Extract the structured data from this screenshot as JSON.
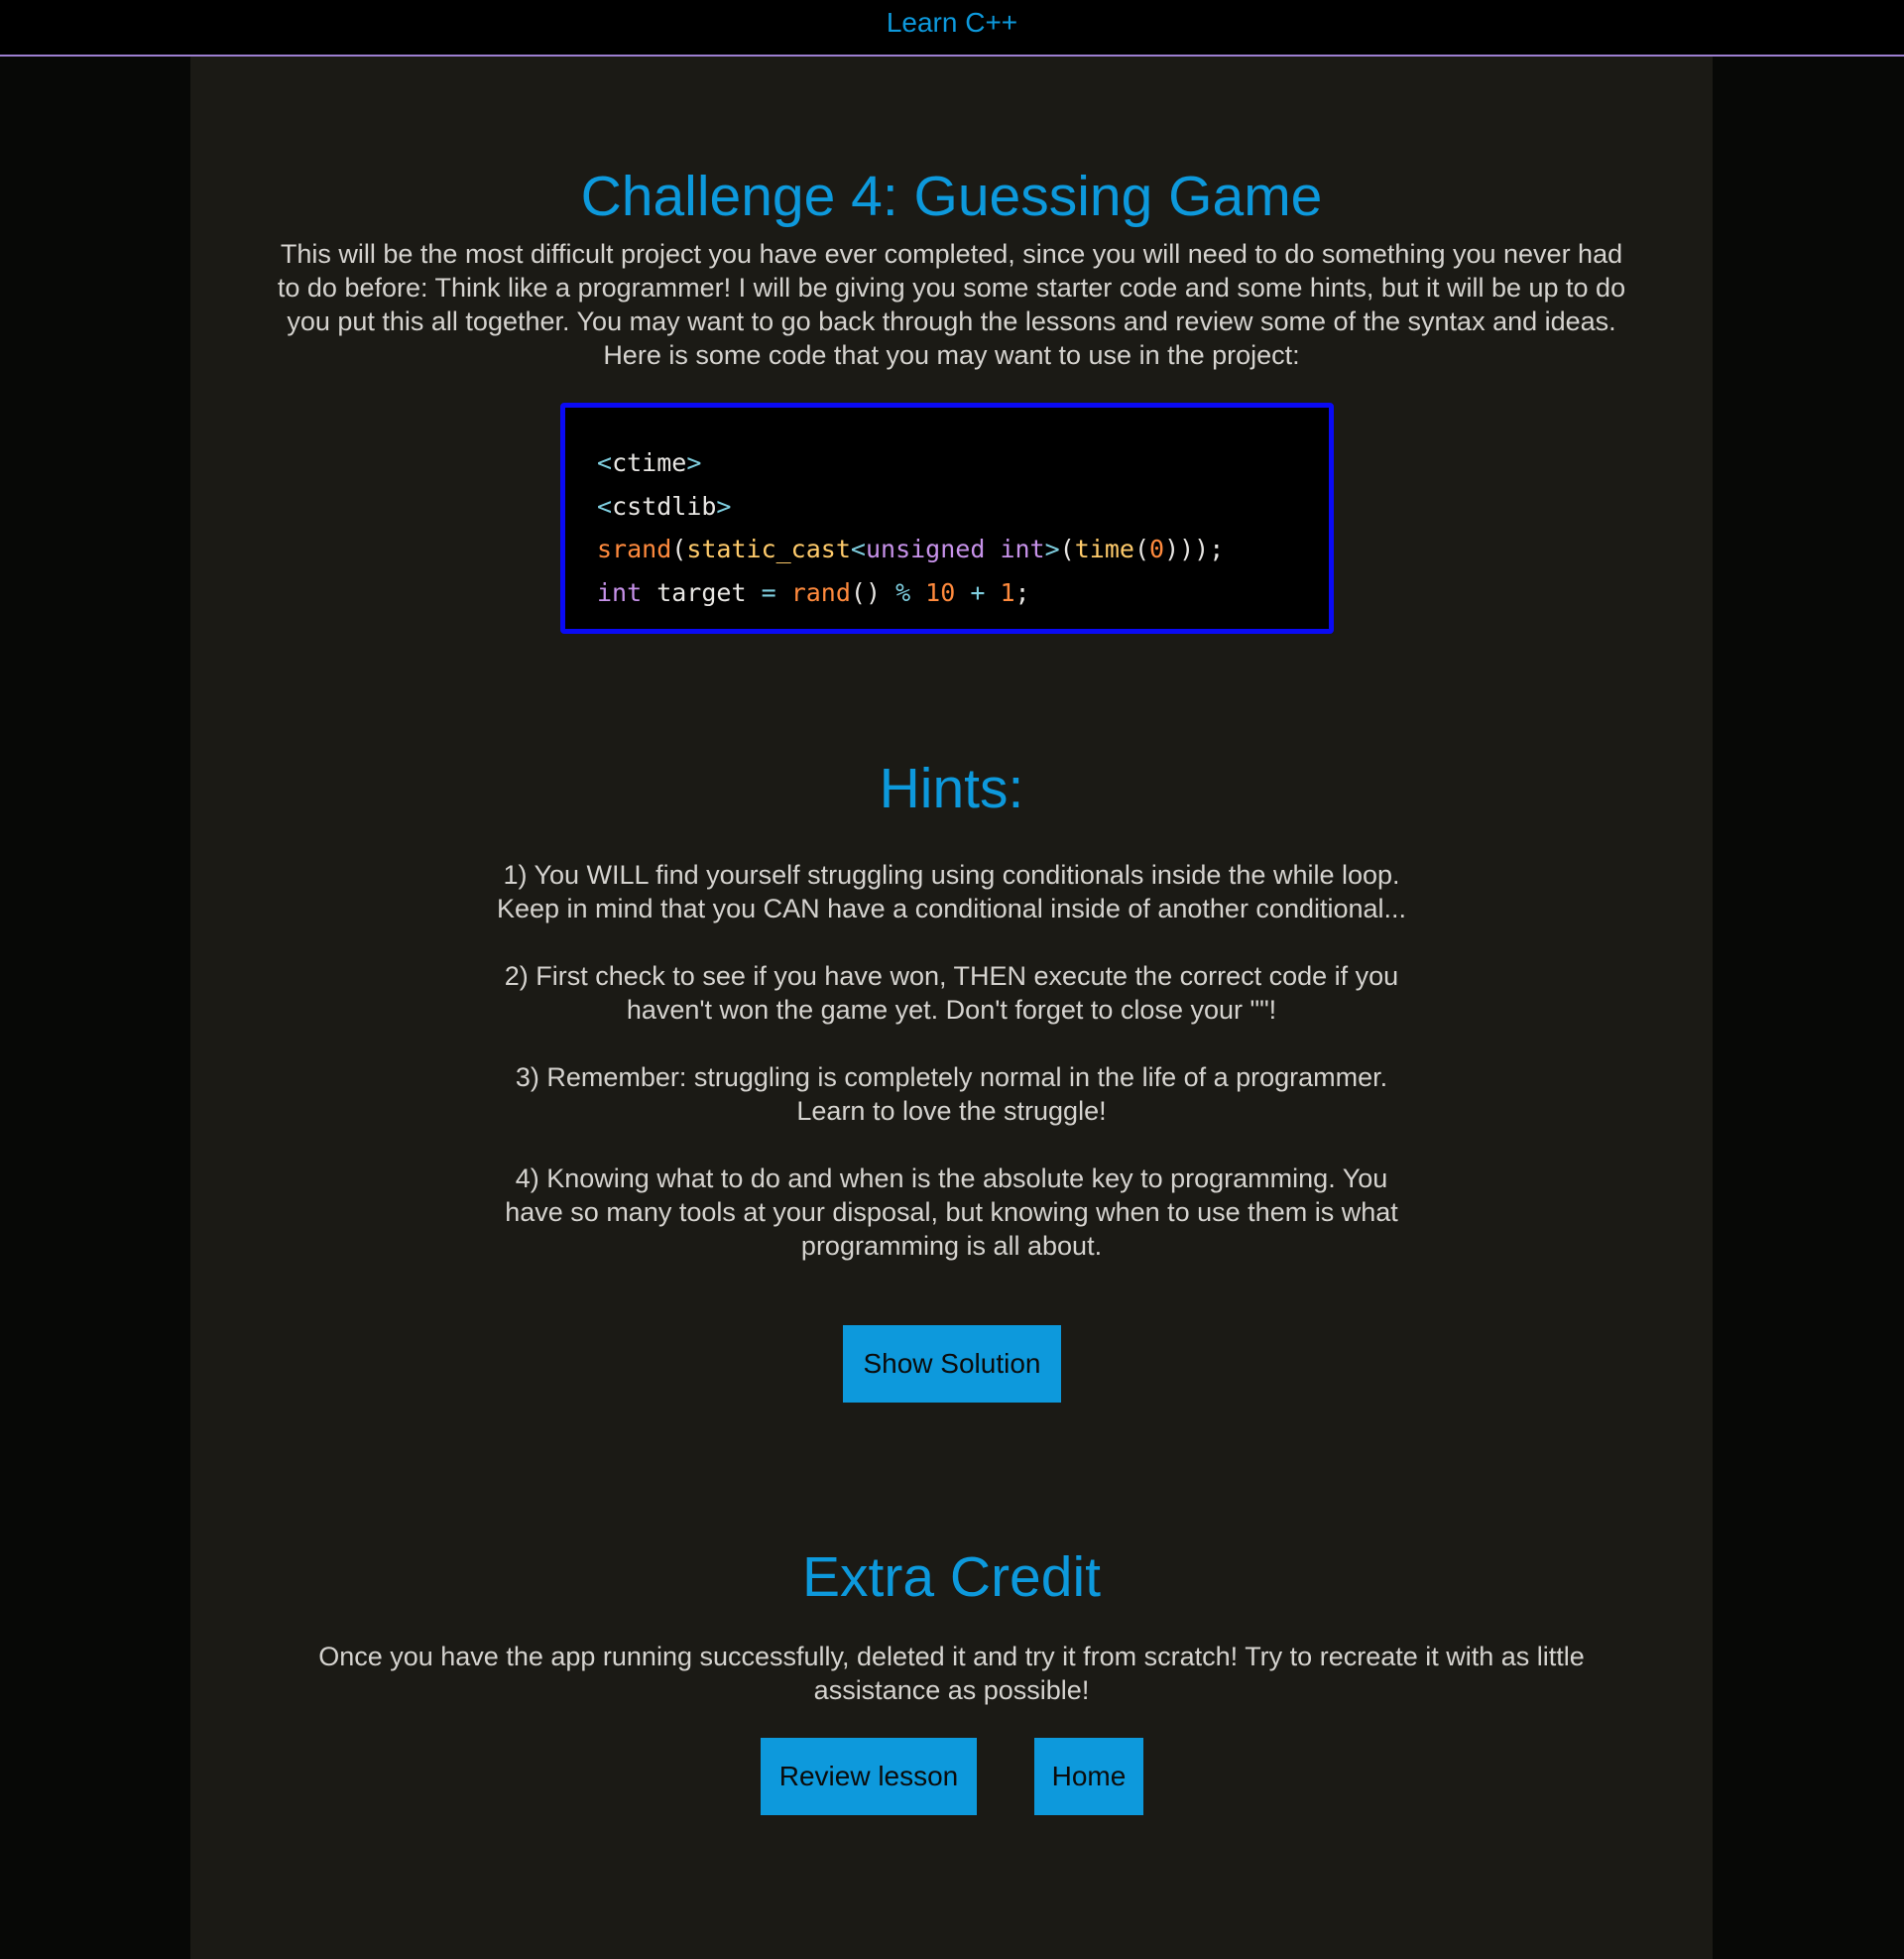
{
  "nav": {
    "brand": "Learn C++"
  },
  "page": {
    "title": "Challenge 4: Guessing Game",
    "intro": "This will be the most difficult project you have ever completed, since you will need to do something you never had to do before: Think like a programmer! I will be giving you some starter code and some hints, but it will be up to do you put this all together. You may want to go back through the lessons and review some of the syntax and ideas. Here is some code that you may want to use in the project:"
  },
  "code": {
    "line1": {
      "open": "<",
      "name": "ctime",
      "close": ">"
    },
    "line2": {
      "open": "<",
      "name": "cstdlib",
      "close": ">"
    },
    "line3": {
      "srand": "srand",
      "paren_open": "(",
      "static_cast": "static_cast",
      "lt": "<",
      "unsigned": "unsigned",
      "space": " ",
      "int": "int",
      "gt": ">",
      "paren2": "(",
      "time": "time",
      "paren3": "(",
      "zero": "0",
      "closing": ")));"
    },
    "line4": {
      "int": "int",
      "target": " target ",
      "eq": "=",
      "rand": " rand",
      "parens": "() ",
      "mod": "%",
      "ten": " 10 ",
      "plus": "+",
      "one": " 1",
      "semi": ";"
    }
  },
  "hints": {
    "title": "Hints:",
    "items": [
      {
        "line1": "1) You WILL find yourself struggling using conditionals inside the while loop.",
        "line2": "Keep in mind that you CAN have a conditional inside of another conditional..."
      },
      {
        "line1": "2) First check to see if you have won, THEN execute the correct code if you",
        "line2": "haven't won the game yet. Don't forget to close your \"\"!"
      },
      {
        "line1": "3) Remember: struggling is completely normal in the life of a programmer.",
        "line2": "Learn to love the struggle!"
      },
      {
        "line1": "4) Knowing what to do and when is the absolute key to programming. You",
        "line2": "have so many tools at your disposal, but knowing when to use them is what",
        "line3": "programming is all about."
      }
    ]
  },
  "buttons": {
    "show_solution": "Show Solution",
    "review_lesson": "Review lesson",
    "home": "Home"
  },
  "extra": {
    "title": "Extra Credit",
    "text": "Once you have the app running successfully, deleted it and try it from scratch! Try to recreate it with as little assistance as possible!"
  },
  "colors": {
    "accent": "#0d99dc",
    "background": "#1b1a15",
    "code_border": "#0a0af5",
    "nav_border": "#9d7fd1"
  }
}
